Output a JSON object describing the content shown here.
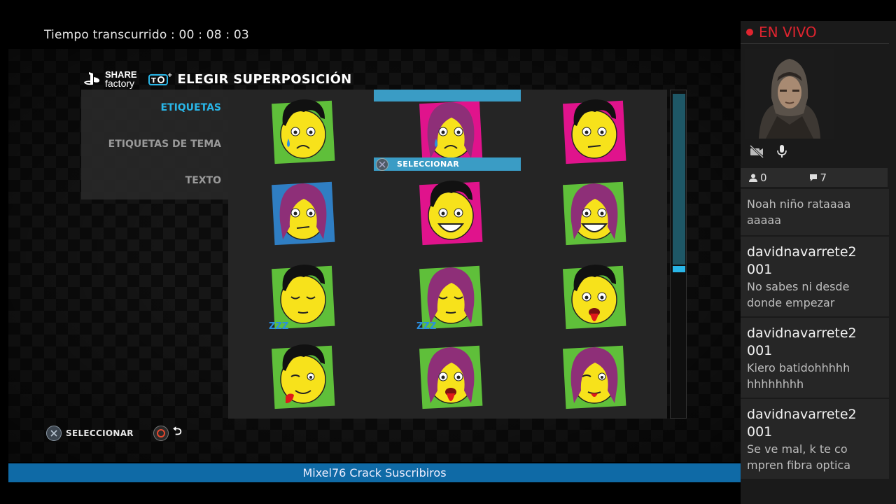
{
  "elapsed": "Tiempo transcurrido :  00 : 08 : 03",
  "brand": {
    "share": "SHARE",
    "factory": "factory"
  },
  "overlay_title": "ELEGIR SUPERPOSICIÓN",
  "menu": [
    {
      "label": "ETIQUETAS",
      "active": true
    },
    {
      "label": "ETIQUETAS DE TEMA",
      "active": false
    },
    {
      "label": "TEXTO",
      "active": false
    }
  ],
  "stickers": [
    {
      "name": "boy-crying",
      "hair": "boy",
      "bg": "green"
    },
    {
      "name": "girl-crying",
      "hair": "girl",
      "bg": "pink",
      "selected": true
    },
    {
      "name": "boy-meh",
      "hair": "boy",
      "bg": "pink"
    },
    {
      "name": "girl-meh",
      "hair": "girl",
      "bg": "blue"
    },
    {
      "name": "boy-grin",
      "hair": "boy",
      "bg": "pink"
    },
    {
      "name": "girl-grin",
      "hair": "girl",
      "bg": "green"
    },
    {
      "name": "boy-sleep",
      "hair": "boy",
      "bg": "green"
    },
    {
      "name": "girl-sleep",
      "hair": "girl",
      "bg": "green"
    },
    {
      "name": "boy-tongue",
      "hair": "boy",
      "bg": "green"
    },
    {
      "name": "boy-wink-tongue",
      "hair": "boy",
      "bg": "green"
    },
    {
      "name": "girl-tongue",
      "hair": "girl",
      "bg": "green"
    },
    {
      "name": "girl-wink",
      "hair": "girl",
      "bg": "green"
    }
  ],
  "selection_label": "SELECCIONAR",
  "hints": {
    "select": "SELECCIONAR"
  },
  "banner": "Mixel76 Crack Suscribiros",
  "live": {
    "label": "EN VIVO",
    "viewers": "0",
    "comments": "7"
  },
  "chat": [
    {
      "user": "",
      "message_lines": [
        "Noah niño rataaaa",
        "aaaaa"
      ]
    },
    {
      "user_lines": [
        "davidnavarrete2",
        "001"
      ],
      "message_lines": [
        "No sabes ni desde",
        "donde empezar"
      ]
    },
    {
      "user_lines": [
        "davidnavarrete2",
        "001"
      ],
      "message_lines": [
        "Kiero batidohhhhh",
        "hhhhhhhh"
      ]
    },
    {
      "user_lines": [
        "davidnavarrete2",
        "001"
      ],
      "message_lines": [
        "Se ve mal, k te co",
        "mpren fibra optica"
      ]
    }
  ],
  "colors": {
    "accent": "#29b6e8",
    "live_red": "#e0242f",
    "banner_blue": "#0f6aa6",
    "sticker_green": "#5fbf3a",
    "sticker_pink": "#e0138c",
    "face_yellow": "#f7e21b",
    "girl_hair": "#8e2f78"
  }
}
